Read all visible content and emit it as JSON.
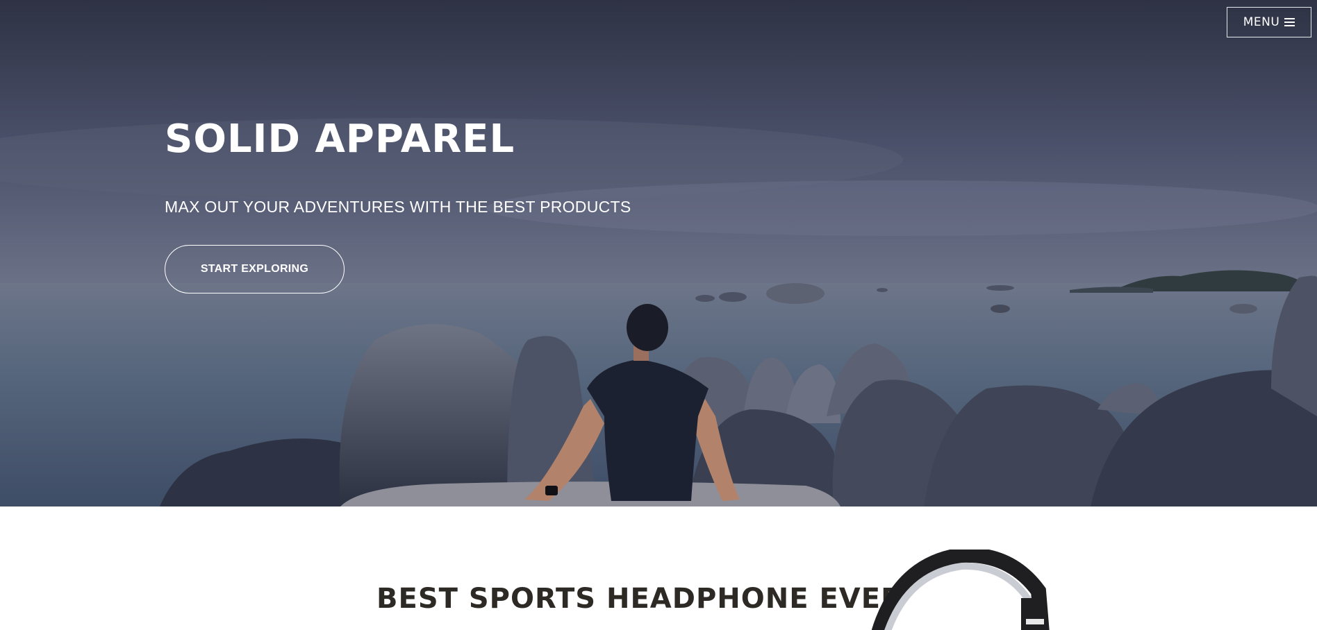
{
  "header": {
    "menu_label": "MENU",
    "menu_icon": "hamburger-icon"
  },
  "hero": {
    "title": "SOLID APPAREL",
    "subtitle": "MAX OUT YOUR ADVENTURES WITH THE BEST PRODUCTS",
    "cta_label": "START EXPLORING",
    "image": "person-sitting-on-rocks-by-sea-photo"
  },
  "feature": {
    "title": "BEST SPORTS HEADPHONE EVER",
    "image": "headphone-image"
  },
  "colors": {
    "hero_overlay": "#3b4056",
    "text_light": "#ffffff",
    "heading_dark": "#2d2a26",
    "page_background": "#ffffff"
  }
}
